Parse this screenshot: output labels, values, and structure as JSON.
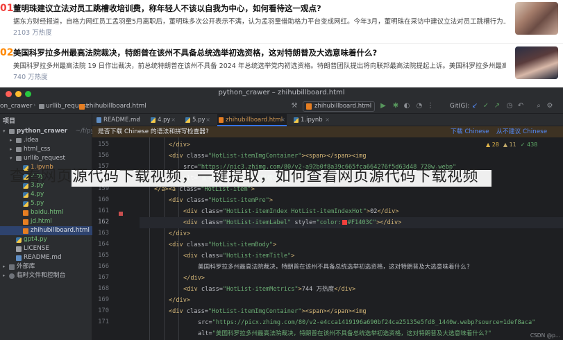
{
  "hot_list": {
    "items": [
      {
        "index": "01",
        "title": "董明珠建议立法对员工跳槽收培训费，称年轻人不该以自我为中心，如何看待这一观点?",
        "excerpt": "据东方财经报道，自格力网红员工孟羽童5月离职后，董明珠多次公开表示不满，认为孟羽童借助格力平台变成网红。今年3月，董明珠在采访中建议立法对员工跳槽行为...",
        "metrics": "2103 万热度"
      },
      {
        "index": "02",
        "title": "美国科罗拉多州最高法院裁决，特朗普在该州不具备总统选举初选资格，这对特朗普及大选意味着什么?",
        "excerpt": "美国科罗拉多州最高法院 19 日作出裁决，前总统特朗普在该州不具备 2024 年总统选举党内初选资格。特朗普团队提出将向联邦最高法院提起上诉。美国科罗拉多州最高...",
        "metrics": "740 万热度"
      }
    ]
  },
  "ide": {
    "window_title": "python_crawer – zhihubillboard.html",
    "breadcrumbs": [
      "on_crawer",
      "urllib_request",
      "zhihubillboard.html"
    ],
    "run_config": "zhihubillboard.html",
    "git_label": "Git(G):",
    "project_header": "项目",
    "tree": [
      {
        "label": "python_crawer",
        "extra": "~/f/python_c",
        "icon": "folder",
        "color": "default",
        "arrow": "▾",
        "depth": 0
      },
      {
        "label": ".idea",
        "icon": "folder",
        "color": "default",
        "arrow": "▸",
        "depth": 1
      },
      {
        "label": "html_css",
        "icon": "folder",
        "color": "default",
        "arrow": "▸",
        "depth": 1
      },
      {
        "label": "urllib_request",
        "icon": "folder",
        "color": "default",
        "arrow": "▾",
        "depth": 1
      },
      {
        "label": "1.ipynb",
        "icon": "py",
        "color": "orange",
        "arrow": "",
        "depth": 2
      },
      {
        "label": "2.py",
        "icon": "py",
        "color": "green",
        "arrow": "",
        "depth": 2
      },
      {
        "label": "3.py",
        "icon": "py",
        "color": "green",
        "arrow": "",
        "depth": 2
      },
      {
        "label": "4.py",
        "icon": "py",
        "color": "green",
        "arrow": "",
        "depth": 2
      },
      {
        "label": "5.py",
        "icon": "py",
        "color": "green",
        "arrow": "",
        "depth": 2
      },
      {
        "label": "baidu.html",
        "icon": "html",
        "color": "green",
        "arrow": "",
        "depth": 2
      },
      {
        "label": "jd.html",
        "icon": "html",
        "color": "green",
        "arrow": "",
        "depth": 2
      },
      {
        "label": "zhihubillboard.html",
        "icon": "html",
        "color": "green",
        "arrow": "",
        "depth": 2,
        "selected": true
      },
      {
        "label": "gpt4.py",
        "icon": "py",
        "color": "green",
        "arrow": "",
        "depth": 1
      },
      {
        "label": "LICENSE",
        "icon": "txt",
        "color": "default",
        "arrow": "",
        "depth": 1
      },
      {
        "label": "README.md",
        "icon": "md",
        "color": "default",
        "arrow": "",
        "depth": 1
      },
      {
        "label": "外部库",
        "icon": "ext",
        "color": "default",
        "arrow": "▸",
        "depth": 0
      },
      {
        "label": "临时文件和控制台",
        "icon": "scratch",
        "color": "default",
        "arrow": "▸",
        "depth": 0
      }
    ],
    "tabs": [
      {
        "label": "README.md",
        "icon": "md"
      },
      {
        "label": "4.py",
        "icon": "py"
      },
      {
        "label": "5.py",
        "icon": "py"
      },
      {
        "label": "zhihubillboard.html",
        "icon": "html",
        "active": true
      },
      {
        "label": "1.ipynb",
        "icon": "py"
      }
    ],
    "language_banner": {
      "question": "是否下载 Chinese 的语法和拼写检查器?",
      "action_download": "下载 Chinese",
      "action_dismiss": "从不建议 Chinese"
    },
    "inspections": {
      "warnings": "▲ 28",
      "weak": "▲ 11",
      "typos": "✓ 438"
    },
    "line_numbers": [
      "155",
      "156",
      "157",
      "158",
      "159",
      "160",
      "161",
      "162",
      "163",
      "164",
      "165",
      "166",
      "167",
      "168",
      "169",
      "170",
      "171"
    ],
    "code_lines": [
      {
        "indent": 2,
        "parts": [
          [
            "tag",
            "</div>"
          ]
        ]
      },
      {
        "indent": 2,
        "parts": [
          [
            "tag",
            "<div "
          ],
          [
            "attr",
            "class="
          ],
          [
            "str",
            "\"HotList-itemImgContainer\""
          ],
          [
            "tag",
            "><span></span><img"
          ]
        ]
      },
      {
        "indent": 3,
        "parts": [
          [
            "attr",
            "src="
          ],
          [
            "str",
            "\"https://pic3.zhimg.com/80/v2-a92b0f8a39c665fca664276f5d63d48_720w.webp\""
          ]
        ]
      },
      {
        "indent": 3,
        "parts": [
          [
            "attr",
            "alt="
          ],
          [
            "str",
            "\"董明珠建议立法对员工跳槽收培训费\""
          ]
        ]
      },
      {
        "indent": 1,
        "parts": [
          [
            "tag",
            "</a><a "
          ],
          [
            "attr",
            "class="
          ],
          [
            "str",
            "\"HotList-item\""
          ],
          [
            "tag",
            ">"
          ]
        ]
      },
      {
        "indent": 2,
        "parts": [
          [
            "tag",
            "<div "
          ],
          [
            "attr",
            "class="
          ],
          [
            "str",
            "\"HotList-itemPre\""
          ],
          [
            "tag",
            ">"
          ]
        ]
      },
      {
        "indent": 3,
        "parts": [
          [
            "tag",
            "<div "
          ],
          [
            "attr",
            "class="
          ],
          [
            "str",
            "\"HotList-itemIndex HotList-itemIndexHot\""
          ],
          [
            "tag",
            ">"
          ],
          [
            "text",
            "02"
          ],
          [
            "tag",
            "</div>"
          ]
        ]
      },
      {
        "indent": 3,
        "parts": [
          [
            "tag",
            "<div "
          ],
          [
            "attr",
            "class="
          ],
          [
            "str",
            "\"HotList-itemLabel\" "
          ],
          [
            "attr",
            "style="
          ],
          [
            "str",
            "\"color:"
          ],
          [
            "color",
            ""
          ],
          [
            "str",
            "#F1403C\""
          ],
          [
            "tag",
            "></div>"
          ]
        ]
      },
      {
        "indent": 2,
        "parts": [
          [
            "tag",
            "</div>"
          ]
        ]
      },
      {
        "indent": 2,
        "parts": [
          [
            "tag",
            "<div "
          ],
          [
            "attr",
            "class="
          ],
          [
            "str",
            "\"HotList-itemBody\""
          ],
          [
            "tag",
            ">"
          ]
        ]
      },
      {
        "indent": 3,
        "parts": [
          [
            "tag",
            "<div "
          ],
          [
            "attr",
            "class="
          ],
          [
            "str",
            "\"HotList-itemTitle\""
          ],
          [
            "tag",
            ">"
          ]
        ]
      },
      {
        "indent": 4,
        "parts": [
          [
            "text",
            "美国科罗拉多州最高法院裁决，特朗普在该州不具备总统选举初选资格，这对特朗普及大选意味着什么?"
          ]
        ]
      },
      {
        "indent": 3,
        "parts": [
          [
            "tag",
            "</div>"
          ]
        ]
      },
      {
        "indent": 3,
        "parts": [
          [
            "tag",
            "<div "
          ],
          [
            "attr",
            "class="
          ],
          [
            "str",
            "\"HotList-itemMetrics\""
          ],
          [
            "tag",
            ">"
          ],
          [
            "text",
            "744 万热度"
          ],
          [
            "tag",
            "</div>"
          ]
        ]
      },
      {
        "indent": 2,
        "parts": [
          [
            "tag",
            "</div>"
          ]
        ]
      },
      {
        "indent": 2,
        "parts": [
          [
            "tag",
            "<div "
          ],
          [
            "attr",
            "class="
          ],
          [
            "str",
            "\"HotList-itemImgContainer\""
          ],
          [
            "tag",
            "><span></span><img"
          ]
        ]
      },
      {
        "indent": 4,
        "parts": [
          [
            "attr",
            "src="
          ],
          [
            "str",
            "\"https://picx.zhimg.com/80/v2-e4cca1419196a690bf24ca25135e5fd8_1440w.webp?source=1def8aca\""
          ]
        ]
      },
      {
        "indent": 4,
        "parts": [
          [
            "attr",
            "alt="
          ],
          [
            "str",
            "\"美国科罗拉多州最高法院裁决，特朗普在该州不具备总统选举初选资格，这对特朗普及大选意味着什么?\""
          ]
        ]
      }
    ],
    "watermark": "CSDN @p..."
  },
  "overlay_caption": "查看网页源代码下载视频，一键提取，如何查看网页源代码下载视频",
  "colors": {
    "hot_index_1": "#F1403C",
    "hot_index_2": "#FF8800",
    "ide_bg": "#1E1F22",
    "html_tag": "#D5B778",
    "html_string": "#6AAB73"
  }
}
